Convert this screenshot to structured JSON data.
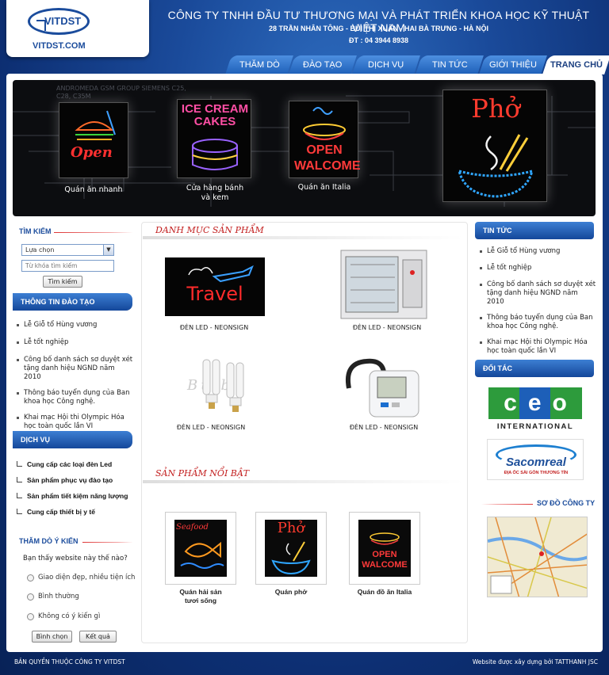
{
  "header": {
    "logo_text": "VITDST",
    "logo_url": "VITDST.COM",
    "company_name": "CÔNG TY TNHH ĐẦU TƯ THƯƠNG MẠI VÀ PHÁT TRIỂN KHOA HỌC KỸ THUẬT VIỆT NAM",
    "address": "28 TRẦN NHÂN TÔNG - BÙI THỊ XUÂN - HAI BÀ TRƯNG - HÀ NỘI",
    "phone": "ĐT : 04 3944 8938"
  },
  "nav": {
    "tabs": [
      {
        "label": "THĂM DÒ"
      },
      {
        "label": "ĐÀO TẠO"
      },
      {
        "label": "DỊCH VỤ"
      },
      {
        "label": "TIN TỨC"
      },
      {
        "label": "GIỚI THIỆU"
      },
      {
        "label": "TRANG CHỦ",
        "active": true
      }
    ]
  },
  "banner": {
    "items": [
      {
        "caption": "Quán ăn nhanh",
        "sign_text": "Open"
      },
      {
        "caption": "Cửa hàng bánh\nvà kem",
        "sign_text": "ICE CREAM CAKES"
      },
      {
        "caption": "Quán ăn Italia",
        "sign_text": "OPEN WALCOME"
      },
      {
        "caption": "",
        "sign_text": "Phở"
      }
    ],
    "bg_text": "ANDROMEDA GSM GROUP SIEMENS C25, C28, C35M"
  },
  "search": {
    "title": "TÌM KIẾM",
    "select_value": "Lựa chọn",
    "input_placeholder": "Từ khóa tìm kiếm",
    "button_label": "Tìm kiếm"
  },
  "training": {
    "title": "THÔNG TIN ĐÀO TẠO",
    "items": [
      "Lễ Giỗ tổ Hùng vương",
      "Lễ tốt nghiệp",
      "Công bố danh sách sơ duyệt xét tặng danh hiệu NGND năm 2010",
      "Thông báo tuyển dụng của Ban khoa học Công nghệ.",
      "Khai mạc Hội thi Olympic Hóa học toàn quốc lần VI"
    ]
  },
  "services": {
    "title": "DỊCH VỤ",
    "items": [
      "Cung cấp các loại đèn Led",
      "Sản phẩm phục vụ đào tạo",
      "Sản phẩm tiết kiệm năng lượng",
      "Cung cấp thiết bị y tế"
    ]
  },
  "poll": {
    "title": "THĂM DÒ Ý KIẾN",
    "question": "Bạn thấy website này thế nào?",
    "options": [
      "Giao diện đẹp, nhiều tiện ích",
      "Bình thường",
      "Không có ý kiến gì"
    ],
    "vote_label": "Bình chọn",
    "result_label": "Kết quả"
  },
  "categories": {
    "title": "DANH MỤC SẢN PHẨM",
    "products": [
      {
        "caption": "ĐÈN LED - NEONSIGN",
        "image": "Travel"
      },
      {
        "caption": "ĐÈN LED - NEONSIGN"
      },
      {
        "caption": "ĐÈN LED - NEONSIGN",
        "image": "Bulb"
      },
      {
        "caption": "ĐÈN LED - NEONSIGN"
      }
    ]
  },
  "featured": {
    "title": "SẢN PHẨM NỔI BẬT",
    "items": [
      {
        "caption": "Quán hải sản\ntươi sống",
        "sign_text": "Seafood"
      },
      {
        "caption": "Quán phở",
        "sign_text": "Phở"
      },
      {
        "caption": "Quán đồ ăn Italia",
        "sign_text": "OPEN WALCOME"
      }
    ]
  },
  "news": {
    "title": "TIN TỨC",
    "items": [
      "Lễ Giỗ tổ Hùng vương",
      "Lễ tốt nghiệp",
      "Công bố danh sách sơ duyệt xét tặng danh hiệu NGND năm 2010",
      "Thông báo tuyển dụng của Ban khoa học Công nghệ.",
      "Khai mạc Hội thi Olympic Hóa học toàn quốc lần VI"
    ]
  },
  "partners": {
    "title": "ĐỐI TÁC",
    "items": [
      {
        "name": "ceo",
        "subtitle": "INTERNATIONAL"
      },
      {
        "name": "Sacomreal",
        "subtitle": "ĐỊA ỐC SÀI GÒN THƯƠNG TÍN"
      }
    ]
  },
  "sitemap": {
    "title": "SƠ ĐỒ CÔNG TY"
  },
  "footer": {
    "left": "BẢN QUYỀN THUỘC CÔNG TY VITDST",
    "right": "Website được xây dựng bởi TATTHANH JSC"
  },
  "colors": {
    "brand": "#1b4c9c",
    "accent_red": "#c32020",
    "nav_blue": "#1d5fb8"
  }
}
